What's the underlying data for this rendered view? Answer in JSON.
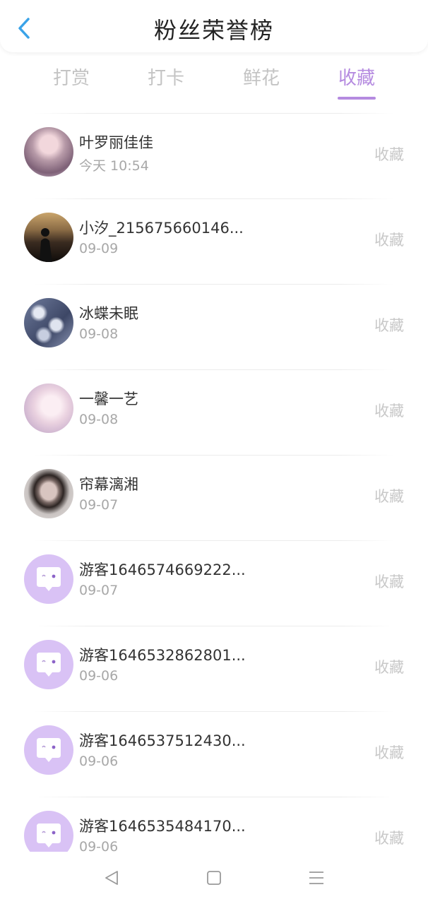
{
  "header": {
    "title": "粉丝荣誉榜",
    "back_icon": "chevron-left-icon"
  },
  "colors": {
    "accent": "#b58be0",
    "tab_inactive": "#c4c4c4",
    "back": "#3aa3e8",
    "guest_avatar_bg": "#d9c2f5"
  },
  "tabs": [
    {
      "label": "打赏",
      "active": false
    },
    {
      "label": "打卡",
      "active": false
    },
    {
      "label": "鲜花",
      "active": false
    },
    {
      "label": "收藏",
      "active": true
    }
  ],
  "fans": [
    {
      "name": "叶罗丽佳佳",
      "time": "今天 10:54",
      "action": "收藏",
      "avatar": "photo-avatar-pink-girl"
    },
    {
      "name": "小汐_215675660146...",
      "time": "09-09",
      "action": "收藏",
      "avatar": "photo-avatar-sunset-silhouette"
    },
    {
      "name": "冰蝶未眠",
      "time": "09-08",
      "action": "收藏",
      "avatar": "photo-avatar-blue-flowers"
    },
    {
      "name": "一馨一艺",
      "time": "09-08",
      "action": "收藏",
      "avatar": "photo-avatar-anime-pastel"
    },
    {
      "name": "帘幕漓湘",
      "time": "09-07",
      "action": "收藏",
      "avatar": "photo-avatar-boy-portrait"
    },
    {
      "name": "游客1646574669222...",
      "time": "09-07",
      "action": "收藏",
      "avatar": "guest-chat-bubble-avatar"
    },
    {
      "name": "游客1646532862801...",
      "time": "09-06",
      "action": "收藏",
      "avatar": "guest-chat-bubble-avatar"
    },
    {
      "name": "游客1646537512430...",
      "time": "09-06",
      "action": "收藏",
      "avatar": "guest-chat-bubble-avatar"
    },
    {
      "name": "游客1646535484170...",
      "time": "09-06",
      "action": "收藏",
      "avatar": "guest-chat-bubble-avatar"
    }
  ],
  "navbar": {
    "icons": [
      "back-triangle-icon",
      "home-square-icon",
      "menu-lines-icon"
    ]
  }
}
